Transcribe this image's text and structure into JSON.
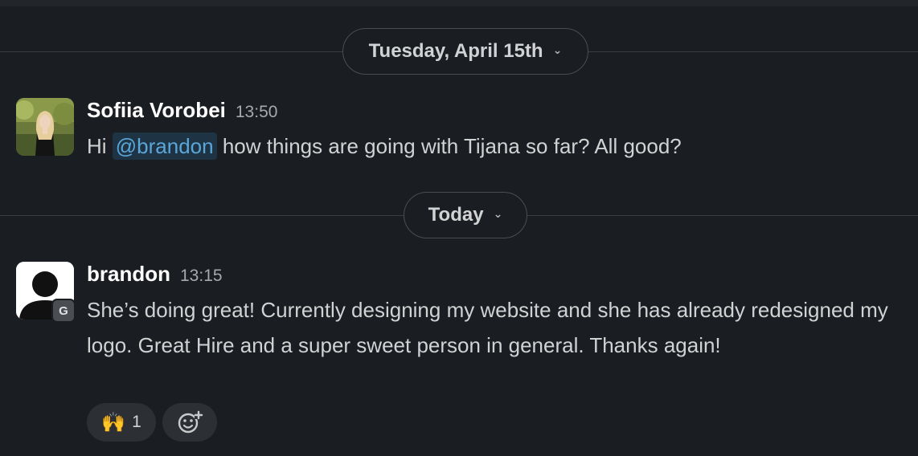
{
  "dividers": [
    {
      "label": "Tuesday, April 15th",
      "chevron": "⌄"
    },
    {
      "label": "Today",
      "chevron": "⌄"
    }
  ],
  "messages": [
    {
      "author": "Sofiia Vorobei",
      "time": "13:50",
      "text_before": "Hi ",
      "mention": "@brandon",
      "text_after": " how things are going with Tijana so far? All good?"
    },
    {
      "author": "brandon",
      "time": "13:15",
      "badge": "G",
      "text": "She’s doing great! Currently designing my website and she has already redesigned my logo. Great Hire and a super sweet person in general. Thanks again!",
      "reactions": [
        {
          "emoji": "🙌",
          "count": "1"
        }
      ]
    }
  ],
  "icons": {
    "raised_hands": "raised-hands-icon",
    "add_reaction": "add-reaction-icon"
  },
  "colors": {
    "background": "#1a1d21",
    "mention_text": "#5ba6d8",
    "mention_bg": "#1e3444"
  }
}
